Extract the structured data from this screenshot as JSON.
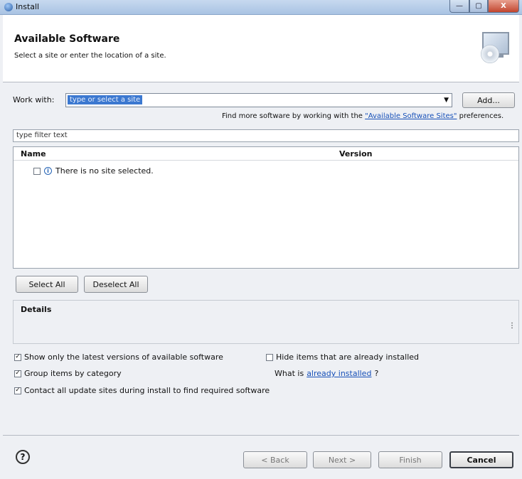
{
  "window": {
    "title": "Install",
    "min": "—",
    "max": "▢",
    "close": "X"
  },
  "header": {
    "title": "Available Software",
    "subtitle": "Select a site or enter the location of a site.",
    "icon": "monitor-cd-icon"
  },
  "work_with": {
    "label": "Work with:",
    "value": "type or select a site",
    "add_label": "Add..."
  },
  "more_software": {
    "prefix": "Find more software by working with the ",
    "link": "\"Available Software Sites\"",
    "suffix": " preferences."
  },
  "filter": {
    "placeholder": "type filter text"
  },
  "table": {
    "columns": [
      "Name",
      "Version"
    ],
    "rows": [
      {
        "checked": false,
        "icon": "info-icon",
        "text": "There is no site selected."
      }
    ]
  },
  "buttons": {
    "select_all": "Select All",
    "deselect_all": "Deselect All"
  },
  "details": {
    "label": "Details"
  },
  "options": {
    "latest": {
      "label": "Show only the latest versions of available software",
      "checked": true
    },
    "hide_installed": {
      "label": "Hide items that are already installed",
      "checked": false
    },
    "group": {
      "label": "Group items by category",
      "checked": true
    },
    "what_is": {
      "prefix": "What is ",
      "link": "already installed",
      "suffix": "?"
    },
    "contact": {
      "label": "Contact all update sites during install to find required software",
      "checked": true
    }
  },
  "footer": {
    "back": "< Back",
    "next": "Next >",
    "finish": "Finish",
    "cancel": "Cancel",
    "help": "?"
  }
}
